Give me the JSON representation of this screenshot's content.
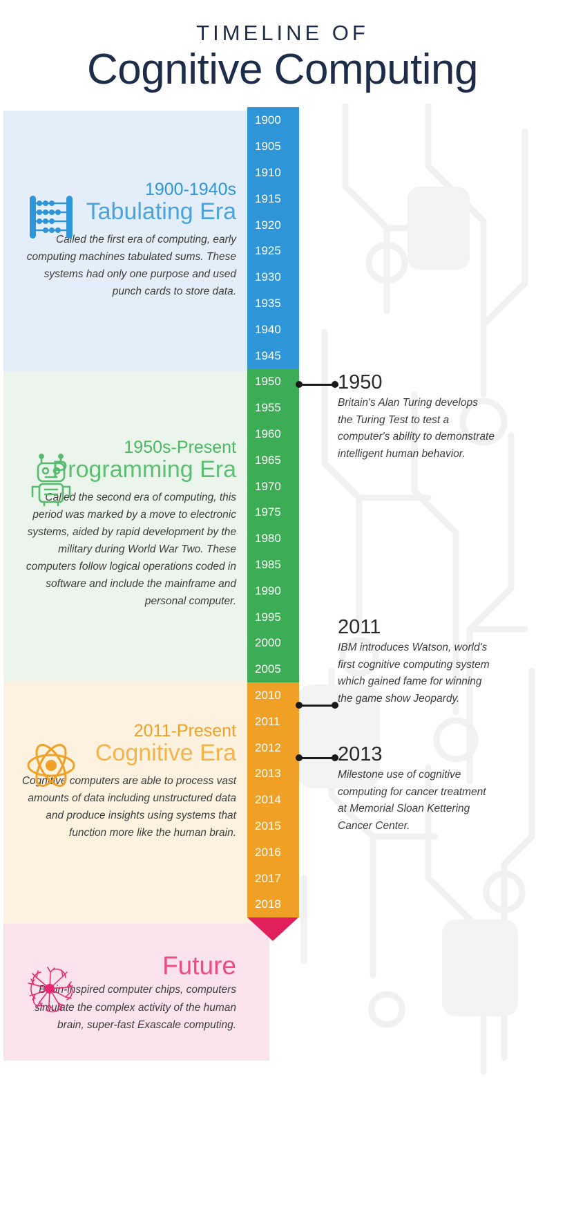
{
  "header": {
    "line1": "TIMELINE OF",
    "line2": "Cognitive Computing"
  },
  "colors": {
    "navy": "#1d2d49",
    "blue": "#2d95d8",
    "blue_bg": "#e4eef8",
    "green": "#3cad55",
    "green_bg": "#ebf5ec",
    "orange": "#f0a125",
    "orange_bg": "#fdf1e0",
    "pink": "#e8266e",
    "pink_bg": "#fbe3ed",
    "text": "#3c3c3c"
  },
  "eras": [
    {
      "id": "tabulating",
      "icon": "abacus-icon",
      "range": "1900-1940s",
      "title": "Tabulating Era",
      "body": "Called the first era of computing, early computing machines tabulated sums. These systems had only one purpose and used punch cards to store data.",
      "accent": "#2d95d8",
      "background": "#e4eef8"
    },
    {
      "id": "programming",
      "icon": "robot-icon",
      "range": "1950s-Present",
      "title": "Programming Era",
      "body": "Called the second era of computing, this period was marked by a move to electronic systems, aided by rapid development by the military during World War Two. These computers follow logical operations coded in software and include the mainframe and personal computer.",
      "accent": "#3cad55",
      "background": "#ebf5ec"
    },
    {
      "id": "cognitive",
      "icon": "atom-icon",
      "range": "2011-Present",
      "title": "Cognitive Era",
      "body": "Cognitive computers are able to process vast amounts of data including unstructured data and produce insights using systems that function more like the human brain.",
      "accent": "#f0a125",
      "background": "#fdf1e0"
    },
    {
      "id": "future",
      "icon": "brain-icon",
      "range": "",
      "title": "Future",
      "body": "Brain-inspired computer chips, computers simulate the complex activity of the human brain, super-fast Exascale computing.",
      "accent": "#e8266e",
      "background": "#fbe3ed"
    }
  ],
  "timeline": {
    "segments": [
      {
        "id": "tabulating-years",
        "color": "#2d95d8",
        "years": [
          "1900",
          "1905",
          "1910",
          "1915",
          "1920",
          "1925",
          "1930",
          "1935",
          "1940",
          "1945"
        ]
      },
      {
        "id": "programming-years",
        "color": "#3cad55",
        "years": [
          "1950",
          "1955",
          "1960",
          "1965",
          "1970",
          "1975",
          "1980",
          "1985",
          "1990",
          "1995",
          "2000",
          "2005"
        ]
      },
      {
        "id": "cognitive-years",
        "color": "#f0a125",
        "years": [
          "2010",
          "2011",
          "2012",
          "2013",
          "2014",
          "2015",
          "2016",
          "2017",
          "2018"
        ]
      }
    ],
    "arrow_color": "#e01f5c"
  },
  "events": [
    {
      "id": "event-1950",
      "year": "1950",
      "body": "Britain's Alan Turing develops the Turing Test to test a computer's ability to demonstrate intelligent human behavior.",
      "connector": true
    },
    {
      "id": "event-2011",
      "year": "2011",
      "body": "IBM introduces Watson, world's first cognitive computing system which gained fame for winning the game show Jeopardy.",
      "connector": true
    },
    {
      "id": "event-2013",
      "year": "2013",
      "body": "Milestone use of cognitive computing for cancer treatment at Memorial Sloan Kettering Cancer Center.",
      "connector": true
    }
  ]
}
